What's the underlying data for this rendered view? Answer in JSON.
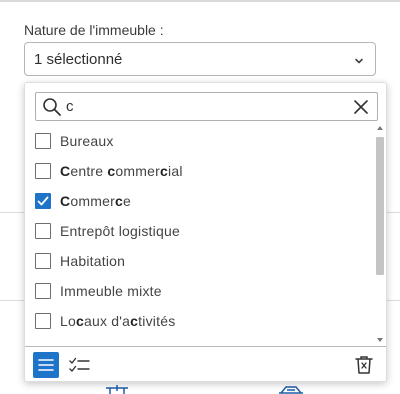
{
  "field": {
    "label": "Nature de l'immeuble :",
    "selected_value": "1 sélectionné",
    "chevron_icon": "chevron-down-icon"
  },
  "dropdown": {
    "search": {
      "value": "c",
      "search_icon": "search-icon",
      "clear_icon": "close-icon"
    },
    "options": [
      {
        "label": "Bureaux",
        "checked": false
      },
      {
        "label": "Centre commercial",
        "checked": false
      },
      {
        "label": "Commerce",
        "checked": true
      },
      {
        "label": "Entrepôt logistique",
        "checked": false
      },
      {
        "label": "Habitation",
        "checked": false
      },
      {
        "label": "Immeuble mixte",
        "checked": false
      },
      {
        "label": "Locaux d'activités",
        "checked": false
      }
    ],
    "footer": {
      "list_view_icon": "list-icon",
      "selected_view_icon": "checklist-icon",
      "clear_selection_icon": "delete-icon"
    }
  },
  "colors": {
    "accent": "#1e74c9",
    "border": "#b5b5b5",
    "text": "#333333"
  }
}
